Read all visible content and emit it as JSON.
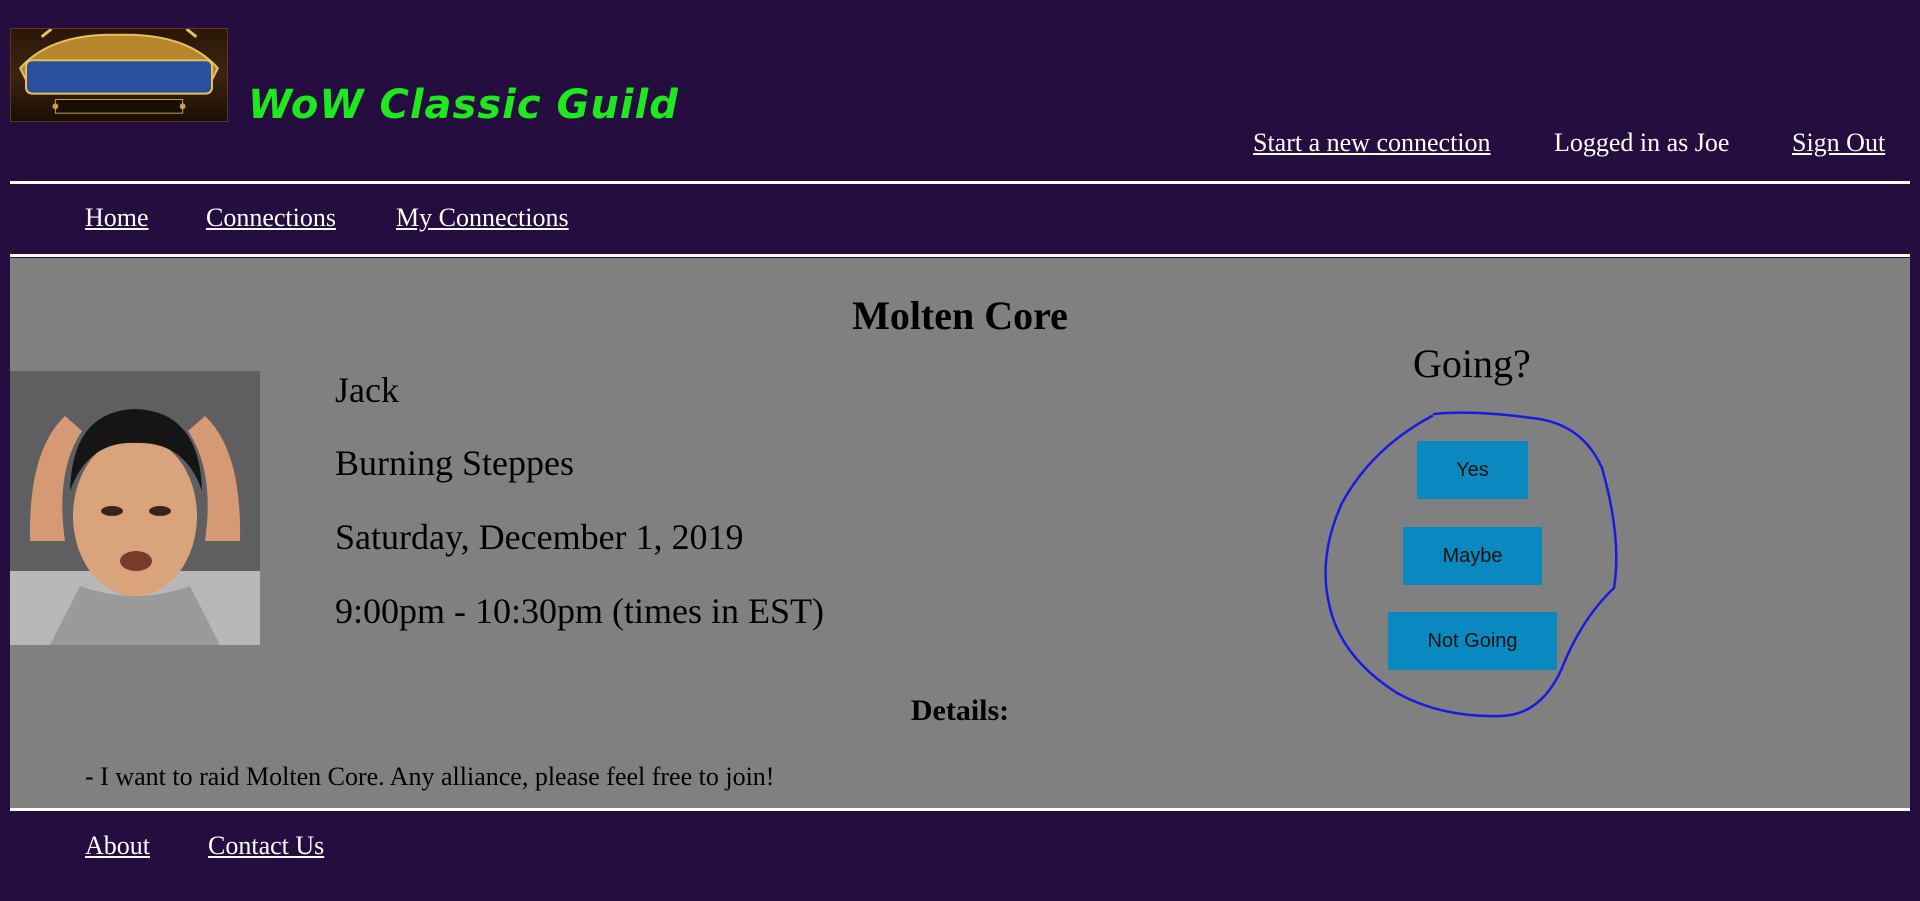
{
  "header": {
    "site_title": "WoW Classic Guild",
    "logo_icon": "world-of-warcraft-classic-logo",
    "links": {
      "new_connection": "Start a new connection",
      "logged_in": "Logged in as Joe",
      "sign_out": "Sign Out"
    }
  },
  "nav": {
    "items": [
      {
        "label": "Home"
      },
      {
        "label": "Connections"
      },
      {
        "label": "My Connections"
      }
    ]
  },
  "event": {
    "title": "Molten Core",
    "host": "Jack",
    "location": "Burning Steppes",
    "date": "Saturday, December 1, 2019",
    "time": "9:00pm - 10:30pm (times in EST)",
    "photo_icon": "host-photo"
  },
  "rsvp": {
    "question": "Going?",
    "options": [
      {
        "label": "Yes"
      },
      {
        "label": "Maybe"
      },
      {
        "label": "Not Going"
      }
    ],
    "button_color": "#0a89c0",
    "annotation_color": "#1a1ae0"
  },
  "details": {
    "heading": "Details:",
    "text": "- I want to raid Molten Core. Any alliance, please feel free to join!"
  },
  "footer": {
    "links": [
      {
        "label": "About"
      },
      {
        "label": "Contact Us"
      }
    ]
  },
  "colors": {
    "page_background": "#250d40",
    "content_background": "#808080",
    "title_green": "#1ee81e"
  }
}
